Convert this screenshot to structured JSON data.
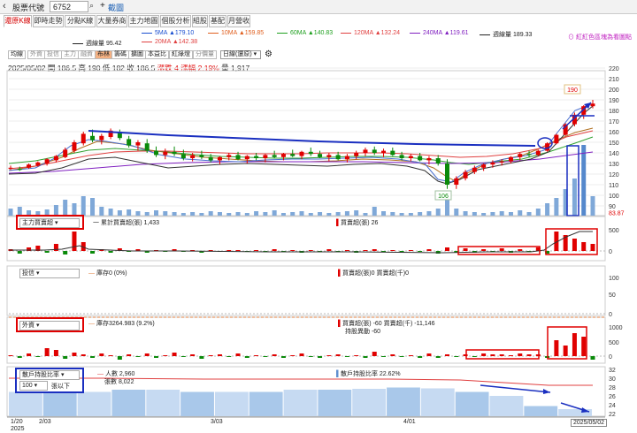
{
  "topbar": {
    "back_icon": "chevron-left-icon",
    "stock_code_label": "股票代號",
    "stock_code_value": "6752",
    "drag_label": "截圖"
  },
  "tabs": [
    "還原K線",
    "即時走勢",
    "分點K線",
    "大量券商",
    "主力地圖",
    "個股分析",
    "組股",
    "基配",
    "月營收"
  ],
  "ma_row1": [
    {
      "label": "5MA ▲179.10",
      "color": "#1a4fd0"
    },
    {
      "label": "10MA ▲159.85",
      "color": "#e06020"
    },
    {
      "label": "60MA ▲140.83",
      "color": "#20a020"
    },
    {
      "label": "120MA ▲132.24",
      "color": "#e04040"
    },
    {
      "label": "240MA ▲119.61",
      "color": "#8020c0"
    },
    {
      "label": "週線量 189.33",
      "color": "#222222"
    }
  ],
  "ma_row2": [
    {
      "label": "週線量 95.42",
      "color": "#222222"
    },
    {
      "label": "20MA ▲142.38",
      "color": "#e04040"
    }
  ],
  "hint": "紅紅色區塊為看圖點",
  "toolbar": [
    "均線",
    "外資",
    "投信",
    "主力",
    "融資",
    "布林",
    "籌碼",
    "擴圖",
    "本益比",
    "紅綠燈",
    "分價量"
  ],
  "toolbar_selected": "布林",
  "date_select": "日線(還原)",
  "ohlc": {
    "date": "2025/05/02",
    "open": "開 186.5",
    "high": "高 190",
    "low": "低 182",
    "close": "收 186.5",
    "change": "漲跌 4",
    "pct": "漲幅 2.19%",
    "vol": "量 1,917"
  },
  "price_axis": [
    "220",
    "210",
    "200",
    "190",
    "180",
    "170",
    "160",
    "150",
    "140",
    "130",
    "120",
    "110",
    "100",
    "90",
    "83.87"
  ],
  "price_labels": {
    "high": "190",
    "low": "106"
  },
  "panel_main_force": {
    "select": "主力買賣超",
    "legend1": "一 累計買賣超(張) 1,433",
    "legend2": "買賣超(張) 26",
    "axis": [
      "500",
      "0"
    ]
  },
  "panel_trust": {
    "select": "投信",
    "legend1": "庫存0 (0%)",
    "legend2": "買賣超(張)0 買賣超(千)0",
    "axis": [
      "100",
      "50",
      "0"
    ]
  },
  "panel_foreign": {
    "select": "外資",
    "legend1": "庫存3264.983 (9.2%)",
    "legend2": "買賣超(張) -60 買賣超(千) -11,146",
    "legend3": "持股異動 -60",
    "axis": [
      "1000",
      "500",
      "0"
    ]
  },
  "panel_holders": {
    "select": "散戶持股比率",
    "select2": "100",
    "select2_label": "張以下",
    "legend1": "人數 2,960",
    "legend2": "張數 8,022",
    "legend3": "散戶持股比率 22.62%",
    "axis": [
      "32",
      "30",
      "28",
      "26",
      "24",
      "22"
    ]
  },
  "x_axis": [
    "1/20\n2025",
    "2/03",
    "3/03",
    "4/01",
    "2025/05/02"
  ]
}
